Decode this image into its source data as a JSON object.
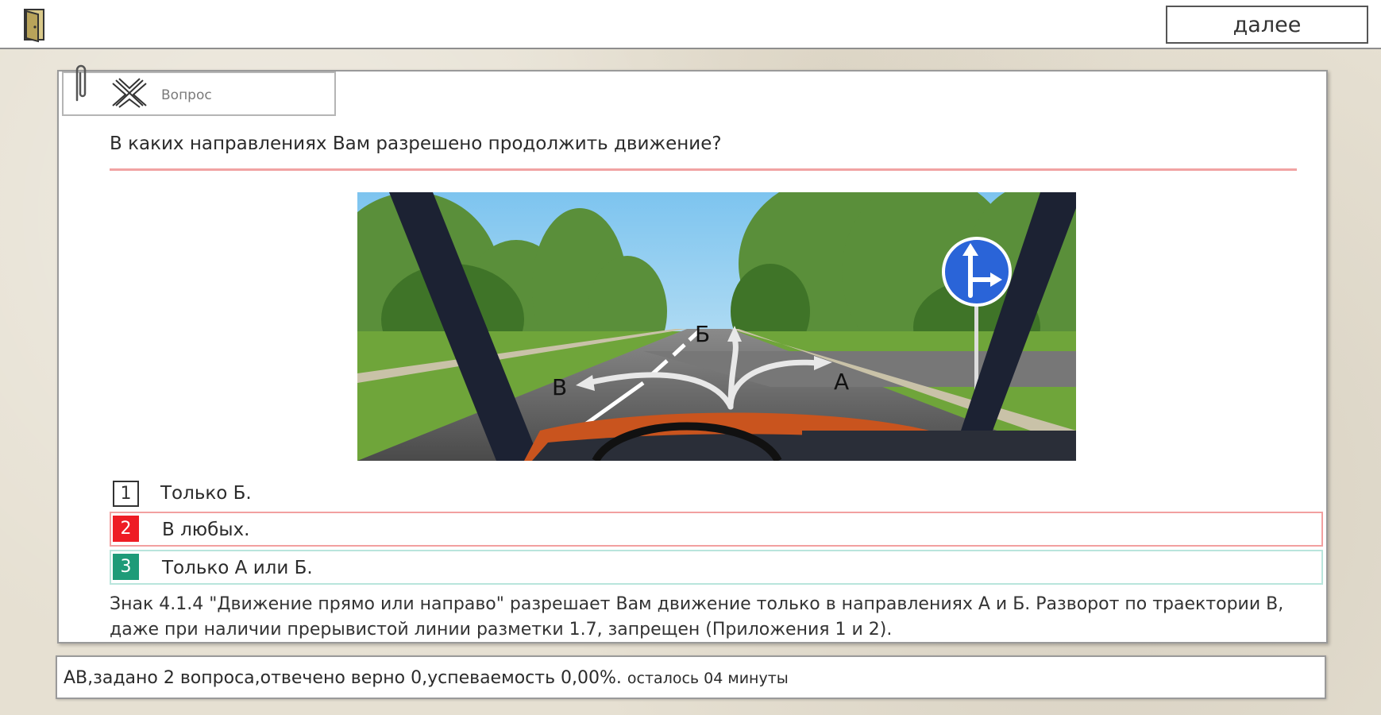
{
  "toolbar": {
    "exit_icon": "door-icon",
    "next_label": "далее"
  },
  "question_card": {
    "clip_icon": "paperclip-icon",
    "tab_icon": "crossroads-icon",
    "tab_label": "Вопрос",
    "question": "В каких направлениях Вам разрешено продолжить движение?",
    "image": {
      "labels": [
        "Б",
        "В",
        "А"
      ],
      "sign": "4.1.4"
    },
    "answers": [
      {
        "number": "1",
        "text": "Только Б.",
        "state": "none"
      },
      {
        "number": "2",
        "text": "В любых.",
        "state": "wrong"
      },
      {
        "number": "3",
        "text": "Только А или Б.",
        "state": "correct"
      }
    ],
    "explanation": "Знак 4.1.4 \"Движение прямо или направо\" разрешает Вам движение только в направлениях А и Б. Разворот по траектории В, даже при наличии прерывистой линии разметки 1.7, запрещен (Приложения 1 и 2)."
  },
  "status": {
    "summary": "АВ,задано 2 вопроса,отвечено верно 0,успеваемость 0,00%.",
    "time_left": "осталось 04 минуты"
  },
  "colors": {
    "wrong": "#ee1c24",
    "correct": "#1e9b78",
    "rule": "#f1a3a3"
  }
}
